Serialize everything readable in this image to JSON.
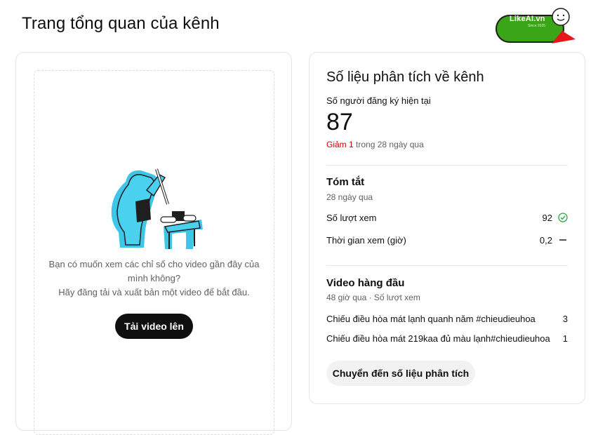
{
  "header": {
    "title": "Trang tổng quan của kênh"
  },
  "watermark": {
    "brand": "LikeAI.vn",
    "tagline": "Since 2025"
  },
  "left_card": {
    "empty_text_line1": "Bạn có muốn xem các chỉ số cho video gần đây của mình không?",
    "empty_text_line2": "Hãy đăng tải và xuất bản một video để bắt đầu.",
    "upload_button": "Tải video lên"
  },
  "analytics": {
    "title": "Số liệu phân tích về kênh",
    "subscribers_label": "Số người đăng ký hiện tại",
    "subscribers_count": "87",
    "change_value": "Giảm 1",
    "change_suffix": " trong 28 ngày qua",
    "summary": {
      "title": "Tóm tắt",
      "period": "28 ngày qua",
      "metrics": [
        {
          "label": "Số lượt xem",
          "value": "92",
          "status_icon": "check-circle-icon"
        },
        {
          "label": "Thời gian xem (giờ)",
          "value": "0,2",
          "status_icon": "dash-icon"
        }
      ]
    },
    "top_videos": {
      "title": "Video hàng đầu",
      "subtitle": "48 giờ qua · Số lượt xem",
      "items": [
        {
          "title": "Chiếu điều hòa mát lạnh quanh năm #chieudieuhoa",
          "views": "3"
        },
        {
          "title": "Chiếu điều hòa mát 219kaa đủ màu lạnh#chieudieuhoa",
          "views": "1"
        }
      ]
    },
    "go_button": "Chuyển đến số liệu phân tích"
  },
  "colors": {
    "negative": "#cc0000",
    "positive_check": "#2ba640",
    "illustration_cyan": "#3ec6e8",
    "button_dark": "#0f0f0f"
  }
}
